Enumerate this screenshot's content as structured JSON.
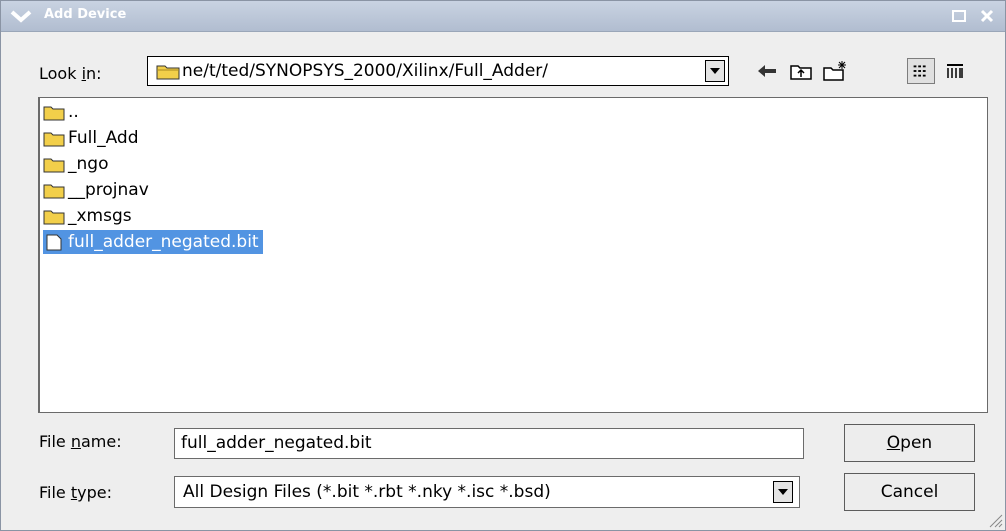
{
  "window": {
    "title": "Add Device"
  },
  "toolbar": {
    "look_in_label": "Look in:",
    "path": "ne/t/ted/SYNOPSYS_2000/Xilinx/Full_Adder/"
  },
  "files": [
    {
      "name": "..",
      "type": "folder",
      "selected": false
    },
    {
      "name": "Full_Add",
      "type": "folder",
      "selected": false
    },
    {
      "name": "_ngo",
      "type": "folder",
      "selected": false
    },
    {
      "name": "__projnav",
      "type": "folder",
      "selected": false
    },
    {
      "name": "_xmsgs",
      "type": "folder",
      "selected": false
    },
    {
      "name": "full_adder_negated.bit",
      "type": "file",
      "selected": true
    }
  ],
  "form": {
    "file_name_label": "File name:",
    "file_name_value": "full_adder_negated.bit",
    "file_type_label": "File type:",
    "file_type_value": "All Design Files (*.bit *.rbt *.nky *.isc *.bsd)"
  },
  "buttons": {
    "open": "Open",
    "cancel": "Cancel"
  },
  "colors": {
    "selection": "#5294e2",
    "folder": "#f2cf4a",
    "titlebar": "#b8c4d6"
  }
}
